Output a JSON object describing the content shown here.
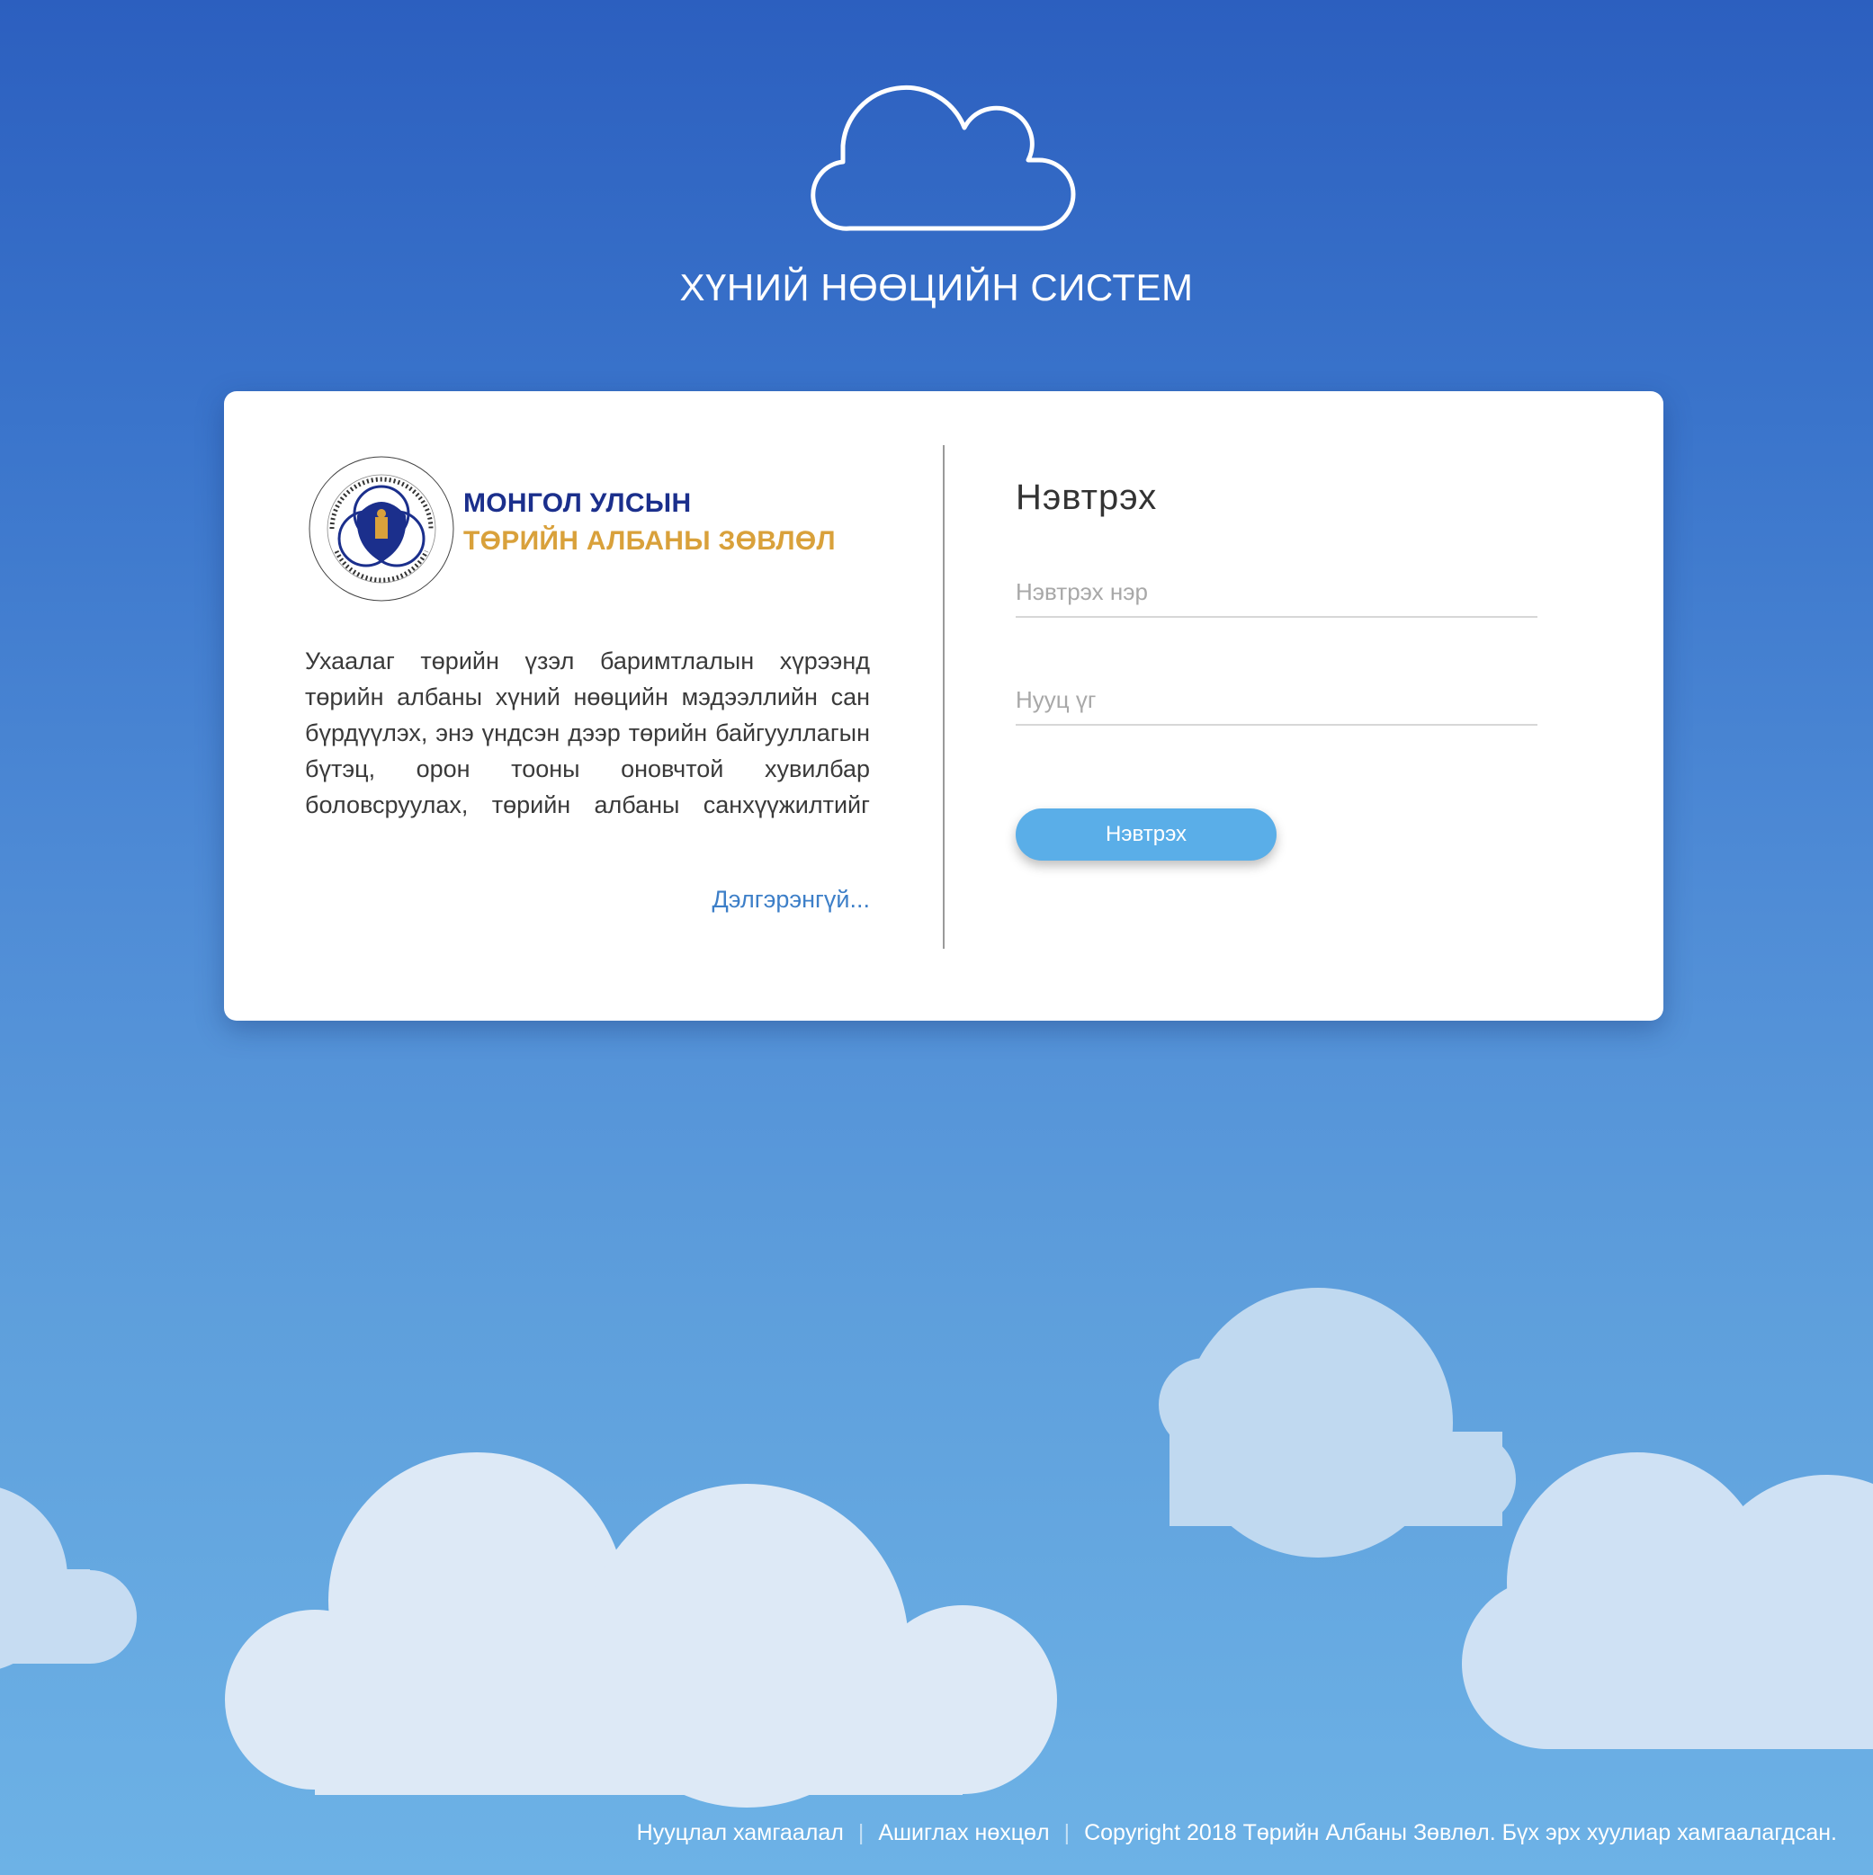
{
  "app": {
    "title": "ХҮНИЙ НӨӨЦИЙН СИСТЕМ",
    "icon": "cloud-icon"
  },
  "organization": {
    "line1": "МОНГОЛ УЛСЫН",
    "line2": "ТӨРИЙН АЛБАНЫ ЗӨВЛӨЛ",
    "logo_ring_text": "МОНГОЛ УЛСЫН ТӨРИЙН АЛБАНЫ ЗӨВЛӨЛ · CIVIL SERVICE COUNCIL OF MONGOLIA",
    "colors": {
      "navy": "#1b2f8c",
      "gold": "#d9a13b"
    }
  },
  "description": {
    "text": "Ухаалаг төрийн үзэл баримтлалын хүрээнд төрийн албаны хүний нөөцийн мэдээллийн сан бүрдүүлэх, энэ үндсэн дээр төрийн байгууллагын бүтэц, орон тооны оновчтой хувилбар боловсруулах, төрийн албаны санхүүжилтийг захиргааны зардлын бодлого,",
    "more_link": "Дэлгэрэнгүй..."
  },
  "login": {
    "title": "Нэвтрэх",
    "username_placeholder": "Нэвтрэх нэр",
    "username_value": "",
    "password_placeholder": "Нууц үг",
    "password_value": "",
    "submit_label": "Нэвтрэх",
    "button_color": "#5aaee8"
  },
  "footer": {
    "privacy": "Нууцлал хамгаалал",
    "terms": "Ашиглах нөхцөл",
    "copyright": "Copyright 2018 Төрийн Албаны Зөвлөл. Бүх эрх хуулиар хамгаалагдсан.",
    "separator": "|"
  }
}
